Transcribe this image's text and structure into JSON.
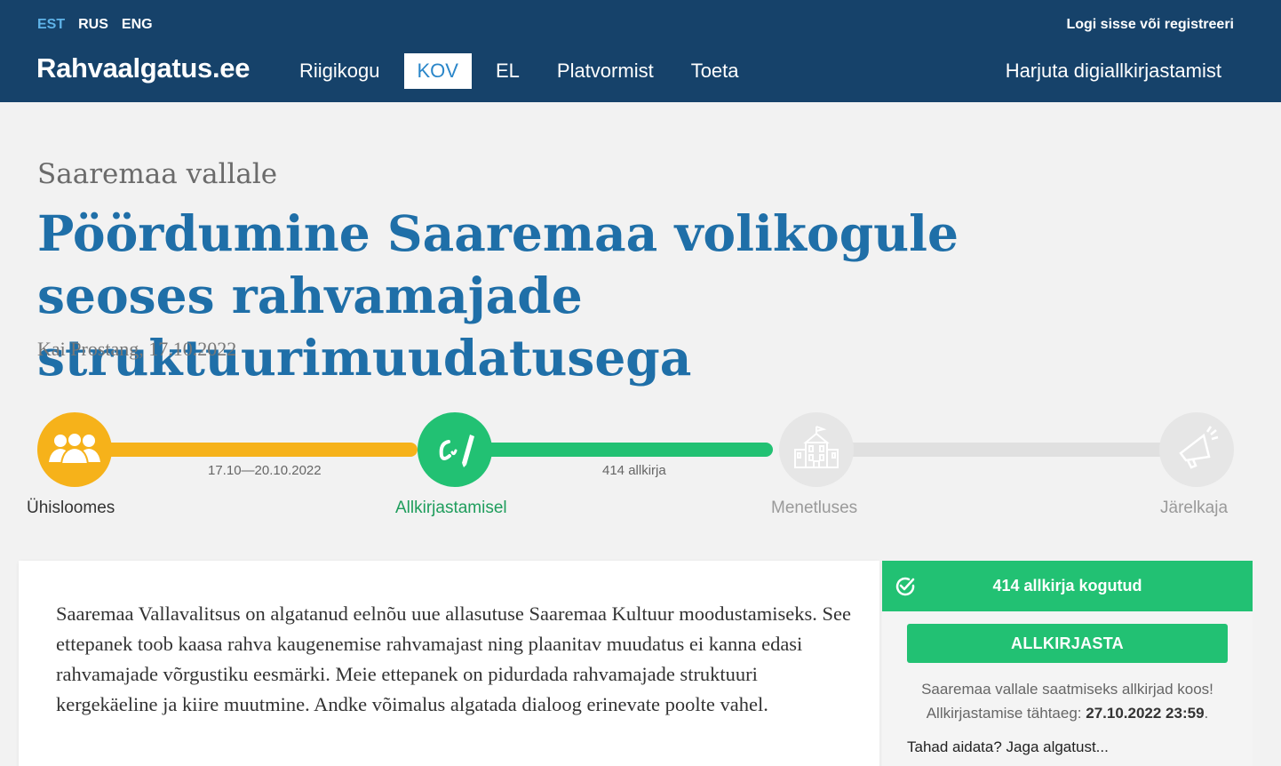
{
  "header": {
    "languages": [
      {
        "label": "EST",
        "active": true
      },
      {
        "label": "RUS",
        "active": false
      },
      {
        "label": "ENG",
        "active": false
      }
    ],
    "login_label": "Logi sisse või registreeri",
    "logo": "Rahvaalgatus.ee",
    "nav": [
      {
        "label": "Riigikogu",
        "active": false
      },
      {
        "label": "KOV",
        "active": true
      },
      {
        "label": "EL",
        "active": false
      },
      {
        "label": "Platvormist",
        "active": false
      },
      {
        "label": "Toeta",
        "active": false
      }
    ],
    "practice_label": "Harjuta digiallkirjastamist"
  },
  "initiative": {
    "destination": "Saaremaa vallale",
    "title": "Pöördumine Saaremaa volikogule seoses rahvamajade struktuurimuudatusega",
    "author_date": "Kai Prostang, 17.10.2022",
    "description": "Saaremaa Vallavalitsus on algatanud eelnõu uue allasutuse Saaremaa Kultuur moodustamiseks. See ettepanek toob kaasa rahva kaugenemise rahvamajast ning plaanitav muudatus ei kanna edasi rahvamajade võrgustiku eesmärki. Meie ettepanek on pidurdada rahvamajade struktuuri kergekäeline ja kiire muutmine. Andke võimalus algatada dialoog erinevate poolte vahel."
  },
  "progress": {
    "steps": [
      {
        "label": "Ühisloomes",
        "icon": "people-icon"
      },
      {
        "label": "Allkirjastamisel",
        "icon": "signature-pen-icon"
      },
      {
        "label": "Menetluses",
        "icon": "building-icon"
      },
      {
        "label": "Järelkaja",
        "icon": "megaphone-icon"
      }
    ],
    "segment1_text": "17.10—20.10.2022",
    "segment2_text": "414 allkirja",
    "colors": {
      "discussion": "#f6b21a",
      "signing": "#22c173",
      "inactive": "#e0e0e0"
    }
  },
  "side": {
    "collected": "414 allkirja kogutud",
    "sign_button": "ALLKIRJASTA",
    "info_line1": "Saaremaa vallale saatmiseks allkirjad koos!",
    "deadline_label": "Allkirjastamise tähtaeg:",
    "deadline_value": "27.10.2022 23:59",
    "share_label": "Tahad aidata? Jaga algatust..."
  }
}
